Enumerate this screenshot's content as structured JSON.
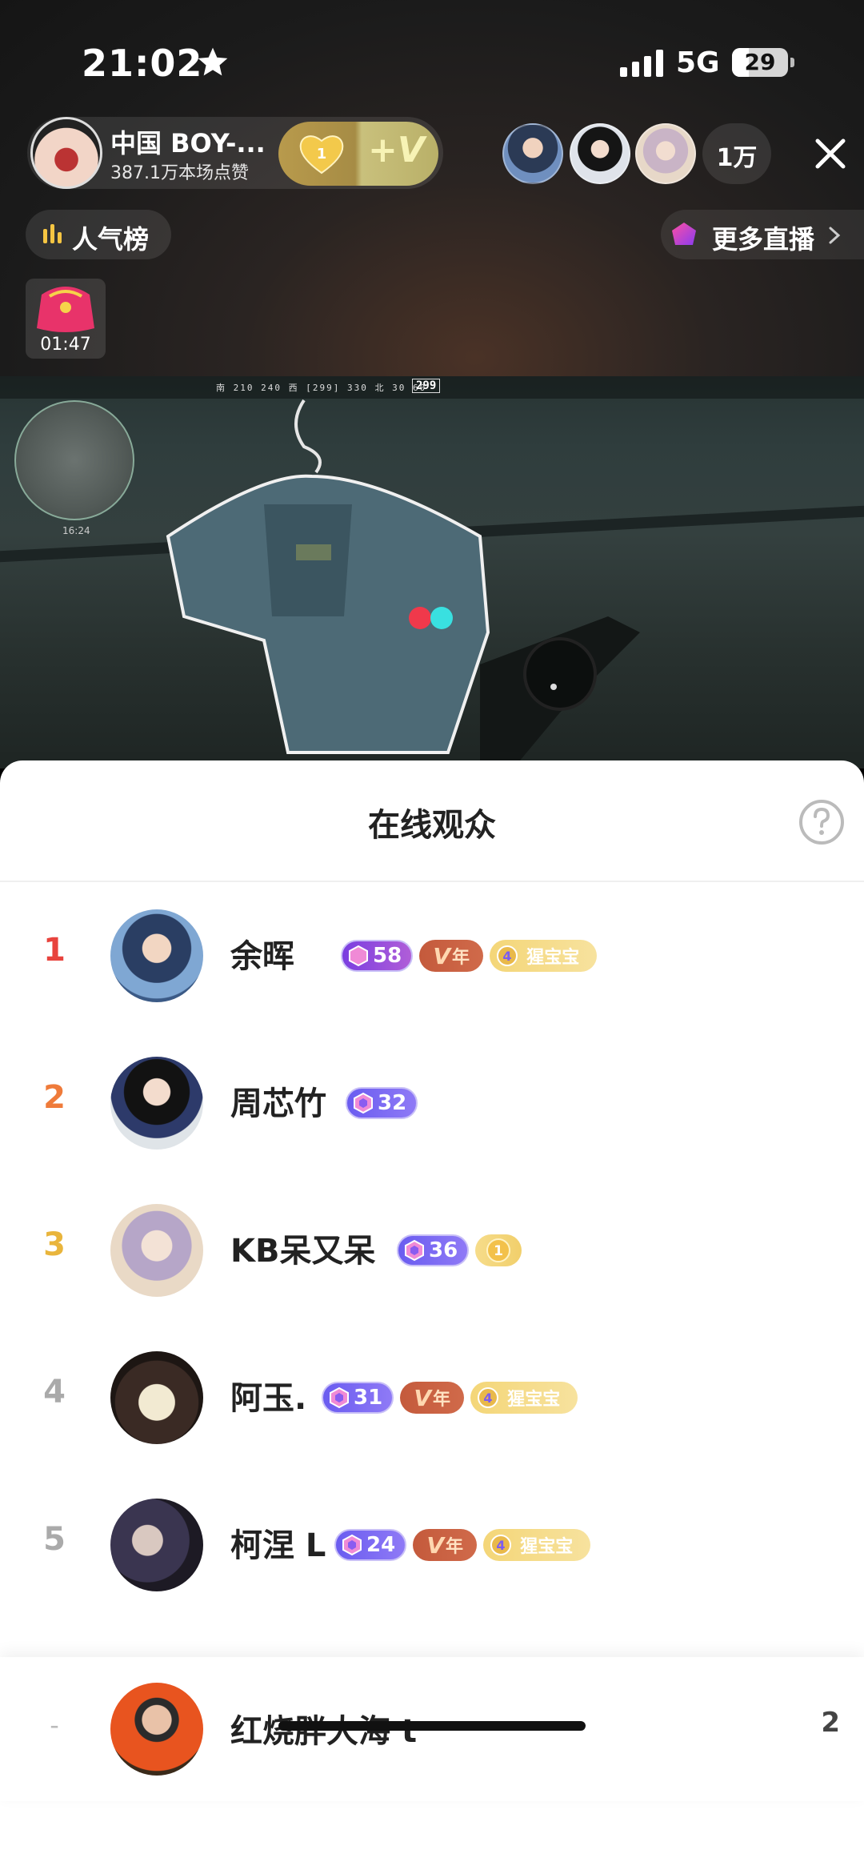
{
  "status_bar": {
    "time": "21:02",
    "network": "5G",
    "battery": "29"
  },
  "anchor": {
    "name": "中国 BOY-...",
    "likes": "387.1万本场点赞",
    "heart_level": "1"
  },
  "viewer_count": "1万",
  "rank_button": "人气榜",
  "more_live": "更多直播",
  "gift_timer": "01:47",
  "game_hud": {
    "compass": "南  210  240  西  [299]  330  北  30  60",
    "heading": "299",
    "minimap_time": "16:24"
  },
  "sheet": {
    "title": "在线观众",
    "viewers": [
      {
        "rank": "1",
        "name": "余晖",
        "level": "58",
        "vip": "年",
        "fan_level": "4",
        "fan_label": "猩宝宝"
      },
      {
        "rank": "2",
        "name": "周芯竹",
        "level": "32"
      },
      {
        "rank": "3",
        "name": "KB呆又呆",
        "level": "36",
        "coin": "1"
      },
      {
        "rank": "4",
        "name": "阿玉.",
        "level": "31",
        "vip": "年",
        "fan_level": "4",
        "fan_label": "猩宝宝"
      },
      {
        "rank": "5",
        "name": "柯涅 L",
        "level": "24",
        "vip": "年",
        "fan_level": "4",
        "fan_label": "猩宝宝"
      }
    ],
    "self": {
      "rank": "-",
      "name": "红烧胖大海 t",
      "score": "2"
    }
  },
  "colors": {
    "rank1": "#e8433d",
    "rank2": "#ef7b3a",
    "rank3": "#e9b53c",
    "rank_other": "#aaaaaa"
  }
}
